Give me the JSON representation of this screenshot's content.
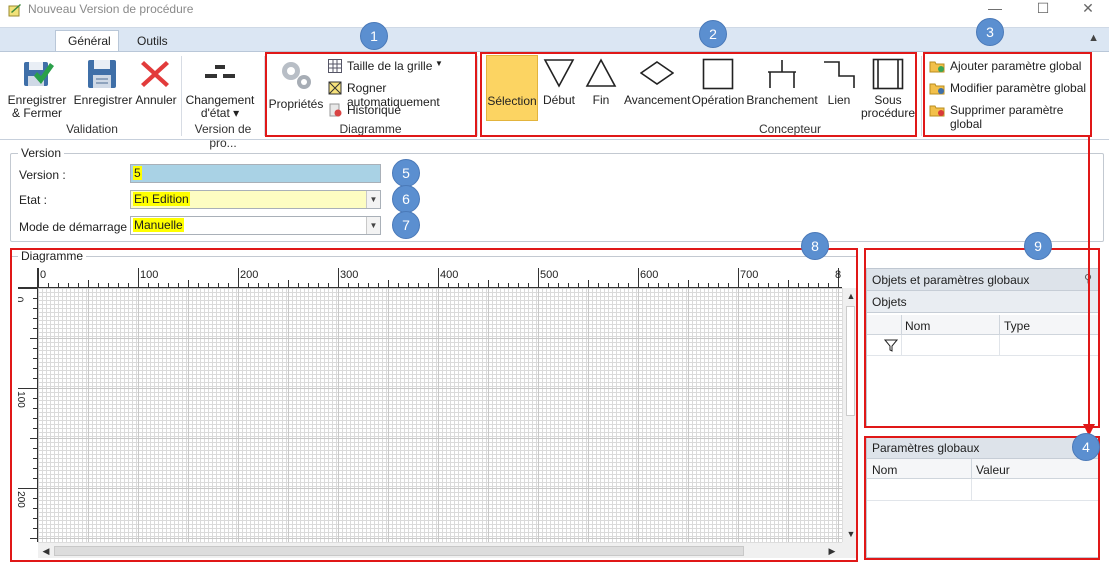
{
  "window": {
    "title": "Nouveau Version de procédure",
    "min": "—",
    "max": "☐",
    "close": "✕"
  },
  "ribbon": {
    "tabs": [
      "Général",
      "Outils"
    ],
    "validation": {
      "save_close": [
        "Enregistrer",
        "& Fermer"
      ],
      "save": "Enregistrer",
      "cancel": "Annuler",
      "group": "Validation"
    },
    "version": {
      "change_state": [
        "Changement",
        "d'état ▾"
      ],
      "group": "Version de pro..."
    },
    "diagramme": {
      "properties": "Propriétés",
      "grid_size": "Taille de la grille",
      "auto_crop": "Rogner automatiquement",
      "history": "Historique",
      "group": "Diagramme"
    },
    "concepteur": {
      "items": [
        "Sélection",
        "Début",
        "Fin",
        "Avancement",
        "Opération",
        "Branchement",
        "Lien"
      ],
      "sub_proc": [
        "Sous",
        "procédure"
      ],
      "group": "Concepteur"
    },
    "params": {
      "add": "Ajouter paramètre global",
      "edit": "Modifier paramètre global",
      "remove": "Supprimer paramètre global"
    }
  },
  "badges": [
    "1",
    "2",
    "3",
    "4",
    "5",
    "6",
    "7",
    "8",
    "9"
  ],
  "version_section": {
    "legend": "Version",
    "version_label": "Version :",
    "version_value": "5",
    "state_label": "Etat :",
    "state_value": "En Edition",
    "mode_label": "Mode de démarrage :",
    "mode_value": "Manuelle"
  },
  "diagram": {
    "legend": "Diagramme",
    "hruler": [
      "0",
      "100",
      "200",
      "300",
      "400",
      "500",
      "600",
      "700",
      "8"
    ],
    "vruler": [
      "0",
      "100",
      "200"
    ]
  },
  "objects_panel": {
    "title": "Objets et paramètres globaux",
    "sub": "Objets",
    "cols": [
      "Nom",
      "Type"
    ]
  },
  "params_panel": {
    "title": "Paramètres globaux",
    "cols": [
      "Nom",
      "Valeur"
    ]
  },
  "colors": {
    "accent": "#5b8fd0",
    "highlight": "#e01818",
    "selected": "#fcd462",
    "version_field": "#a9d2e5",
    "state_field": "#fdfdc2"
  }
}
